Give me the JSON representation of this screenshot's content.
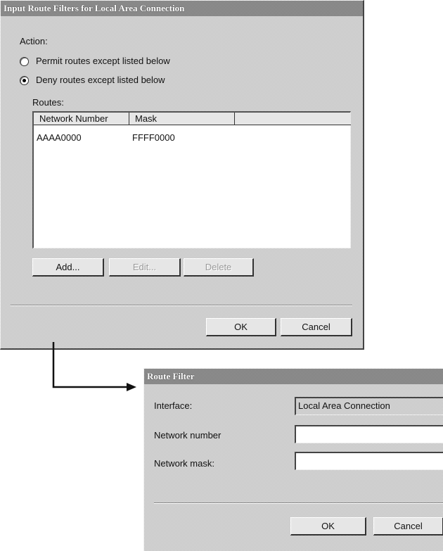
{
  "dialog1": {
    "title": "Input Route Filters for Local Area Connection",
    "action_label": "Action:",
    "radio_permit": "Permit routes except listed below",
    "radio_deny": "Deny routes except listed below",
    "selected_action": "deny",
    "routes_label": "Routes:",
    "columns": [
      "Network Number",
      "Mask"
    ],
    "rows": [
      {
        "network": "AAAA0000",
        "mask": "FFFF0000"
      }
    ],
    "buttons": {
      "add": "Add...",
      "edit": "Edit...",
      "delete": "Delete",
      "ok": "OK",
      "cancel": "Cancel"
    }
  },
  "dialog2": {
    "title": "Route Filter",
    "interface_label": "Interface:",
    "interface_value": "Local Area Connection",
    "network_number_label": "Network number",
    "network_number_value": "",
    "network_mask_label": "Network mask:",
    "network_mask_value": "",
    "buttons": {
      "ok": "OK",
      "cancel": "Cancel"
    }
  },
  "icons": {
    "connector": "arrow-right-icon"
  }
}
